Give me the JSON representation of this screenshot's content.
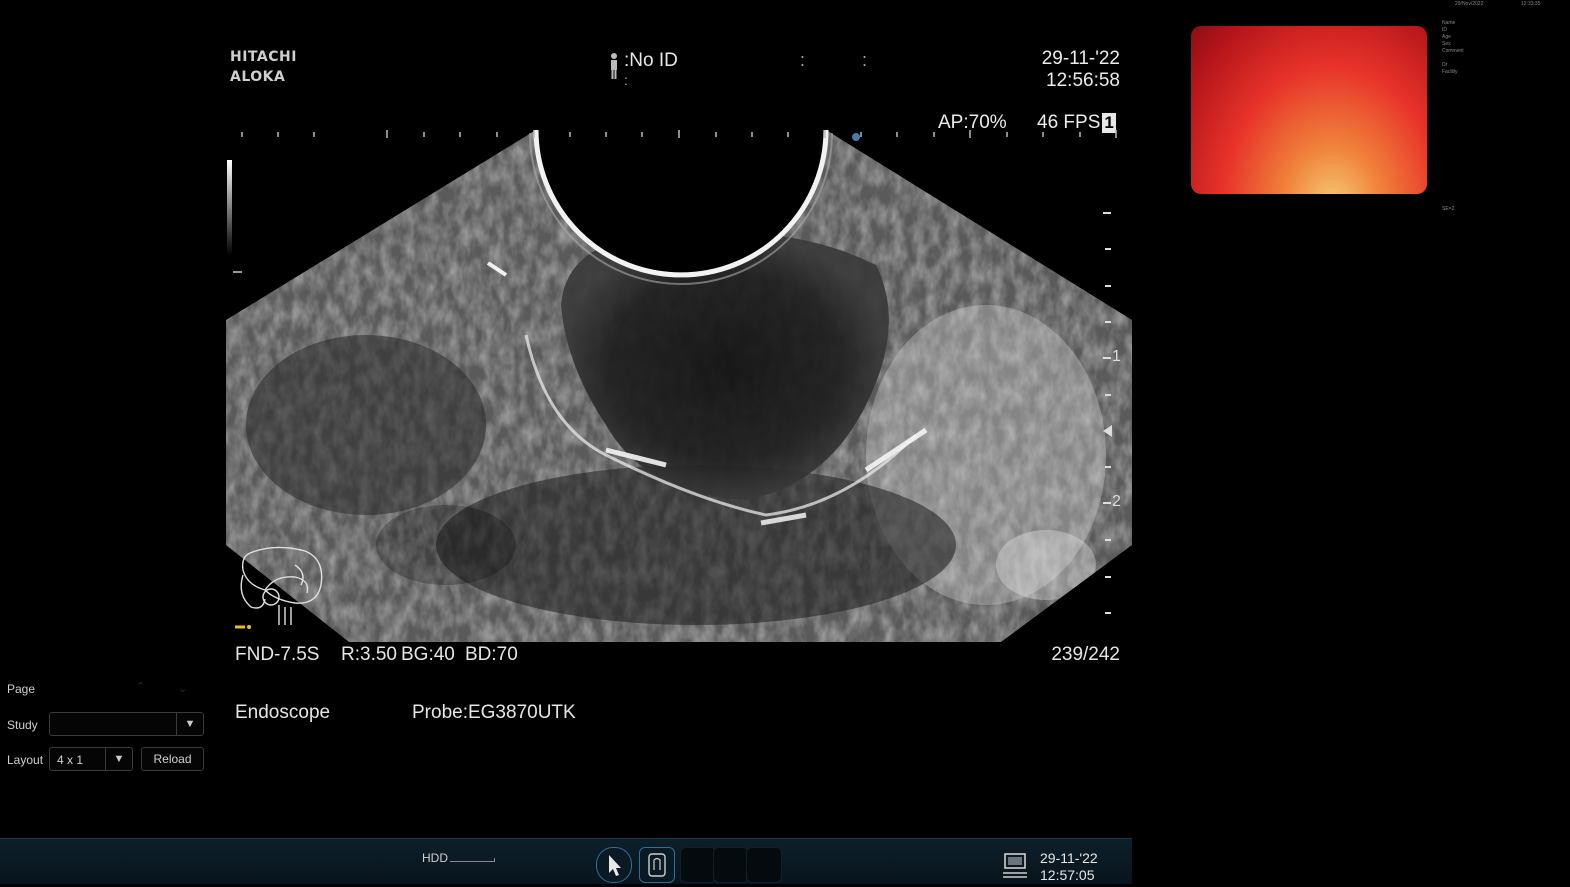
{
  "brand": {
    "line1": "HITACHI",
    "line2": "ALOKA"
  },
  "patient": {
    "id": ":No ID",
    "second": ":"
  },
  "header_colons": [
    ":",
    ":"
  ],
  "datetime": {
    "date": "29-11-'22",
    "time": "12:56:58"
  },
  "ap": "AP:70%",
  "fps": {
    "text": "46 FPS",
    "box": "1"
  },
  "depth_labels": [
    "1",
    "2"
  ],
  "params": {
    "probe_code": "FND-7.5S",
    "r": "R:3.50",
    "bg": "BG:40",
    "bd": "BD:70"
  },
  "frame_counter": "239/242",
  "mode": "Endoscope",
  "probe": "Probe:EG3870UTK",
  "right_panel": {
    "top_date": "29/Nov/2022",
    "top_time": "12:33:35",
    "fields": [
      "Name",
      "ID",
      "Age",
      "Sex",
      "Comment",
      "",
      "Dr",
      "Facility"
    ],
    "se": "SE=2"
  },
  "sidebar": {
    "page_label": "Page",
    "study_label": "Study",
    "study_value": "",
    "layout_label": "Layout",
    "layout_value": "4 x 1",
    "reload_label": "Reload"
  },
  "taskbar": {
    "hdd_label": "HDD",
    "date": "29-11-'22",
    "time": "12:57:05",
    "icons": [
      "pointer-icon",
      "body-mark-icon",
      "monitor-icon"
    ]
  }
}
